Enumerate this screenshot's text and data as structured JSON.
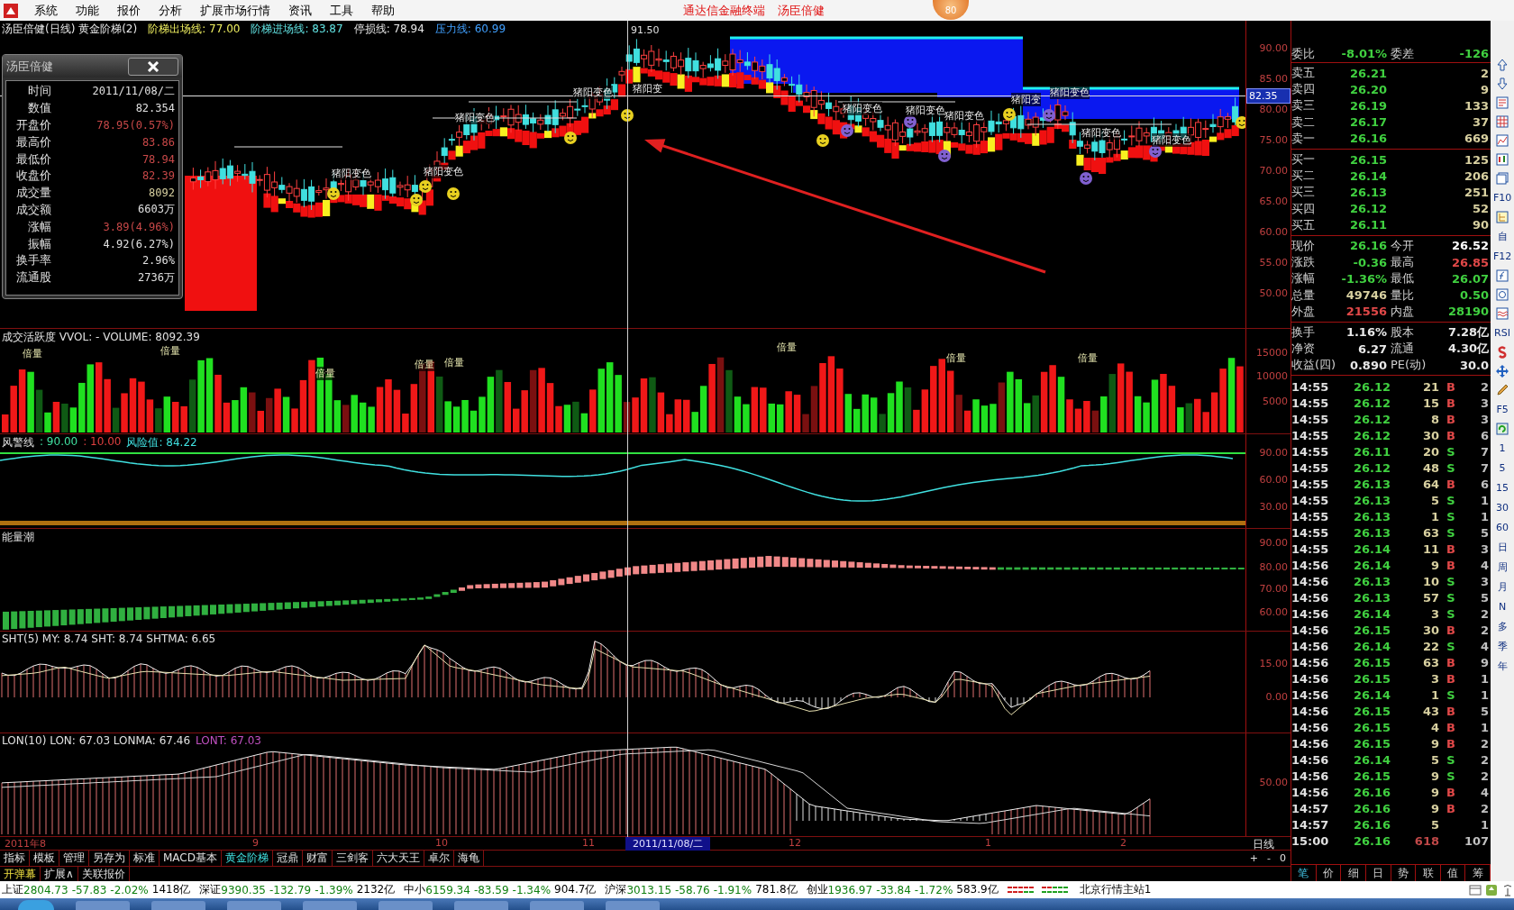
{
  "menu": [
    "系统",
    "功能",
    "报价",
    "分析",
    "扩展市场行情",
    "资讯",
    "工具",
    "帮助"
  ],
  "title": {
    "app": "通达信金融终端",
    "stock": "汤臣倍健",
    "badge": "80"
  },
  "main_chart": {
    "legend": [
      {
        "text": "汤臣倍健(日线) 黄金阶梯(2)",
        "color": "#e8e8e8"
      },
      {
        "text": "阶梯出场线: 77.00",
        "color": "#f0f060"
      },
      {
        "text": "阶梯进场线: 83.87",
        "color": "#60e0e0"
      },
      {
        "text": "停损线: 78.94",
        "color": "#e8e8e8"
      },
      {
        "text": "压力线: 60.99",
        "color": "#40a0ff"
      }
    ],
    "axis_labels": [
      "90.00",
      "85.00",
      "80.00",
      "75.00",
      "70.00",
      "65.00",
      "60.00",
      "55.00",
      "50.00"
    ],
    "cursor_price": "82.35",
    "peak_label": "91.50",
    "signals": [
      "猪阳变色",
      "猪阳变色",
      "猪阳变色",
      "猪阳变色",
      "猪阳变",
      "猪阳变色",
      "猪阳变色",
      "猪阳变色",
      "猪阳变",
      "猪阳变色",
      "猪阳变色",
      "猪阳变色"
    ]
  },
  "popup": {
    "title": "汤臣倍健",
    "rows": [
      {
        "label": "时间",
        "value": "2011/11/08/二",
        "color": "#e0e0e0"
      },
      {
        "label": "数值",
        "value": "82.354",
        "color": "#e0e0e0"
      },
      {
        "label": "开盘价",
        "value": "78.95(0.57%)",
        "color": "#c84848"
      },
      {
        "label": "最高价",
        "value": "83.86",
        "color": "#c84848"
      },
      {
        "label": "最低价",
        "value": "78.94",
        "color": "#c84848"
      },
      {
        "label": "收盘价",
        "value": "82.39",
        "color": "#c84848"
      },
      {
        "label": "成交量",
        "value": "8092",
        "color": "#d8d0a0"
      },
      {
        "label": "成交额",
        "value": "6603万",
        "color": "#e0e0e0"
      },
      {
        "label": "涨幅",
        "value": "3.89(4.96%)",
        "color": "#c84848"
      },
      {
        "label": "振幅",
        "value": "4.92(6.27%)",
        "color": "#e0e0e0"
      },
      {
        "label": "换手率",
        "value": "2.96%",
        "color": "#e0e0e0"
      },
      {
        "label": "流通股",
        "value": "2736万",
        "color": "#e0e0e0"
      }
    ]
  },
  "volume_panel": {
    "legend": "成交活跃度 VVOL: -   VOLUME: 8092.39",
    "axis_labels": [
      "15000",
      "10000",
      "5000"
    ],
    "markers": [
      "倍量",
      "倍量",
      "倍量",
      "倍量",
      "倍量",
      "倍量",
      "倍量",
      "倍量"
    ]
  },
  "warning_panel": {
    "name": "风警线",
    "upper": ": 90.00",
    "lower": ": 10.00",
    "risk": "风险值: 84.22",
    "axis_labels": [
      "90.00",
      "60.00",
      "30.00"
    ]
  },
  "energy_panel": {
    "legend": "能量潮",
    "axis_labels": [
      "90.00",
      "80.00",
      "70.00",
      "60.00"
    ]
  },
  "sht_panel": {
    "legend": "SHT(5)  MY: 8.74  SHT: 8.74  SHTMA: 6.65",
    "axis_labels": [
      "15.00",
      "0.00"
    ]
  },
  "lon_panel": {
    "legend": "LON(10)  LON: 67.03  LONMA: 67.46",
    "lont": "LONT: 67.03",
    "axis_labels": [
      "50.00"
    ]
  },
  "date_axis": {
    "labels": [
      "2011年8",
      "9",
      "10",
      "11",
      "12",
      "1",
      "2"
    ],
    "cursor_date": "2011/11/08/二",
    "period": "日线",
    "controls": [
      "+",
      "-",
      "0"
    ]
  },
  "tabs": [
    {
      "label": "指标",
      "selected": false
    },
    {
      "label": "模板",
      "selected": false
    },
    {
      "label": "管理",
      "selected": false
    },
    {
      "label": "另存为",
      "selected": false
    },
    {
      "label": "标准",
      "selected": false
    },
    {
      "label": "MACD基本",
      "selected": false
    },
    {
      "label": "黄金阶梯",
      "selected": true
    },
    {
      "label": "冠鼎",
      "selected": false
    },
    {
      "label": "财富",
      "selected": false
    },
    {
      "label": "三剑客",
      "selected": false
    },
    {
      "label": "六大天王",
      "selected": false
    },
    {
      "label": "卓尔",
      "selected": false
    },
    {
      "label": "海龟",
      "selected": false
    }
  ],
  "sub_tabs": [
    "开弹幕",
    "扩展∧",
    "关联报价"
  ],
  "quote": {
    "ratio": {
      "label": "委比",
      "value": "-8.01%",
      "label2": "委差",
      "value2": "-126"
    },
    "asks": [
      {
        "label": "卖五",
        "price": "26.21",
        "volume": "2"
      },
      {
        "label": "卖四",
        "price": "26.20",
        "volume": "9"
      },
      {
        "label": "卖三",
        "price": "26.19",
        "volume": "133"
      },
      {
        "label": "卖二",
        "price": "26.17",
        "volume": "37"
      },
      {
        "label": "卖一",
        "price": "26.16",
        "volume": "669"
      }
    ],
    "bids": [
      {
        "label": "买一",
        "price": "26.15",
        "volume": "125"
      },
      {
        "label": "买二",
        "price": "26.14",
        "volume": "206"
      },
      {
        "label": "买三",
        "price": "26.13",
        "volume": "251"
      },
      {
        "label": "买四",
        "price": "26.12",
        "volume": "52"
      },
      {
        "label": "买五",
        "price": "26.11",
        "volume": "90"
      }
    ],
    "stats": [
      {
        "left": {
          "label": "现价",
          "value": "26.16",
          "color": "#40d040"
        },
        "right": {
          "label": "今开",
          "value": "26.52",
          "color": "#ffffff"
        }
      },
      {
        "left": {
          "label": "涨跌",
          "value": "-0.36",
          "color": "#40d040"
        },
        "right": {
          "label": "最高",
          "value": "26.85",
          "color": "#e04848"
        }
      },
      {
        "left": {
          "label": "涨幅",
          "value": "-1.36%",
          "color": "#40d040"
        },
        "right": {
          "label": "最低",
          "value": "26.07",
          "color": "#40d040"
        }
      },
      {
        "left": {
          "label": "总量",
          "value": "49746",
          "color": "#d8d0a0"
        },
        "right": {
          "label": "量比",
          "value": "0.50",
          "color": "#40d040"
        }
      },
      {
        "left": {
          "label": "外盘",
          "value": "21556",
          "color": "#e04848"
        },
        "right": {
          "label": "内盘",
          "value": "28190",
          "color": "#40d040"
        }
      }
    ],
    "finance": [
      {
        "label": "换手",
        "value": "1.16%",
        "label2": "股本",
        "value2": "7.28亿"
      },
      {
        "label": "净资",
        "value": "6.27",
        "label2": "流通",
        "value2": "4.30亿"
      },
      {
        "label": "收益(四)",
        "value": "0.890",
        "label2": "PE(动)",
        "value2": "30.0"
      }
    ],
    "trades": [
      {
        "time": "14:55",
        "price": "26.12",
        "volume": "21",
        "kind": "buy",
        "side": "B",
        "count": "2"
      },
      {
        "time": "14:55",
        "price": "26.12",
        "volume": "15",
        "kind": "buy",
        "side": "B",
        "count": "3"
      },
      {
        "time": "14:55",
        "price": "26.12",
        "volume": "8",
        "kind": "buy",
        "side": "B",
        "count": "3"
      },
      {
        "time": "14:55",
        "price": "26.12",
        "volume": "30",
        "kind": "buy",
        "side": "B",
        "count": "6"
      },
      {
        "time": "14:55",
        "price": "26.11",
        "volume": "20",
        "kind": "sell",
        "side": "S",
        "count": "7"
      },
      {
        "time": "14:55",
        "price": "26.12",
        "volume": "48",
        "kind": "sell",
        "side": "S",
        "count": "7"
      },
      {
        "time": "14:55",
        "price": "26.13",
        "volume": "64",
        "kind": "buy",
        "side": "B",
        "count": "6"
      },
      {
        "time": "14:55",
        "price": "26.13",
        "volume": "5",
        "kind": "sell",
        "side": "S",
        "count": "1"
      },
      {
        "time": "14:55",
        "price": "26.13",
        "volume": "1",
        "kind": "sell",
        "side": "S",
        "count": "1"
      },
      {
        "time": "14:55",
        "price": "26.13",
        "volume": "63",
        "kind": "sell",
        "side": "S",
        "count": "5"
      },
      {
        "time": "14:55",
        "price": "26.14",
        "volume": "11",
        "kind": "buy",
        "side": "B",
        "count": "3"
      },
      {
        "time": "14:56",
        "price": "26.14",
        "volume": "9",
        "kind": "buy",
        "side": "B",
        "count": "4"
      },
      {
        "time": "14:56",
        "price": "26.13",
        "volume": "10",
        "kind": "sell",
        "side": "S",
        "count": "3"
      },
      {
        "time": "14:56",
        "price": "26.13",
        "volume": "57",
        "kind": "sell",
        "side": "S",
        "count": "5"
      },
      {
        "time": "14:56",
        "price": "26.14",
        "volume": "3",
        "kind": "sell",
        "side": "S",
        "count": "2"
      },
      {
        "time": "14:56",
        "price": "26.15",
        "volume": "30",
        "kind": "buy",
        "side": "B",
        "count": "2"
      },
      {
        "time": "14:56",
        "price": "26.14",
        "volume": "22",
        "kind": "sell",
        "side": "S",
        "count": "4"
      },
      {
        "time": "14:56",
        "price": "26.15",
        "volume": "63",
        "kind": "buy",
        "side": "B",
        "count": "9"
      },
      {
        "time": "14:56",
        "price": "26.15",
        "volume": "3",
        "kind": "buy",
        "side": "B",
        "count": "1"
      },
      {
        "time": "14:56",
        "price": "26.14",
        "volume": "1",
        "kind": "sell",
        "side": "S",
        "count": "1"
      },
      {
        "time": "14:56",
        "price": "26.15",
        "volume": "43",
        "kind": "buy",
        "side": "B",
        "count": "5"
      },
      {
        "time": "14:56",
        "price": "26.15",
        "volume": "4",
        "kind": "buy",
        "side": "B",
        "count": "1"
      },
      {
        "time": "14:56",
        "price": "26.15",
        "volume": "9",
        "kind": "buy",
        "side": "B",
        "count": "2"
      },
      {
        "time": "14:56",
        "price": "26.14",
        "volume": "5",
        "kind": "sell",
        "side": "S",
        "count": "2"
      },
      {
        "time": "14:56",
        "price": "26.15",
        "volume": "9",
        "kind": "sell",
        "side": "S",
        "count": "2"
      },
      {
        "time": "14:56",
        "price": "26.16",
        "volume": "9",
        "kind": "buy",
        "side": "B",
        "count": "4"
      },
      {
        "time": "14:57",
        "price": "26.16",
        "volume": "9",
        "kind": "buy",
        "side": "B",
        "count": "2"
      },
      {
        "time": "14:57",
        "price": "26.16",
        "volume": "5",
        "kind": "none",
        "count": "1"
      },
      {
        "time": "15:00",
        "price": "26.16",
        "volume": "618",
        "kind": "total",
        "count": "107"
      }
    ],
    "tabs": [
      {
        "label": "笔",
        "selected": true
      },
      {
        "label": "价",
        "selected": false
      },
      {
        "label": "细",
        "selected": false
      },
      {
        "label": "日",
        "selected": false
      },
      {
        "label": "势",
        "selected": false
      },
      {
        "label": "联",
        "selected": false
      },
      {
        "label": "值",
        "selected": false
      },
      {
        "label": "筹",
        "selected": false
      }
    ]
  },
  "toolbar": [
    {
      "kind": "up"
    },
    {
      "kind": "down"
    },
    {
      "kind": "report"
    },
    {
      "kind": "table"
    },
    {
      "kind": "line"
    },
    {
      "kind": "candles"
    },
    {
      "kind": "pages"
    },
    {
      "kind": "text",
      "label": "F10"
    },
    {
      "kind": "tree"
    },
    {
      "kind": "text",
      "label": "自"
    },
    {
      "kind": "text",
      "label": "F12"
    },
    {
      "kind": "formula"
    },
    {
      "kind": "ring"
    },
    {
      "kind": "wave"
    },
    {
      "kind": "text",
      "label": "RSI"
    },
    {
      "kind": "coin"
    },
    {
      "kind": "move"
    },
    {
      "kind": "pencil"
    },
    {
      "kind": "text",
      "label": "F5"
    },
    {
      "kind": "refresh"
    },
    {
      "kind": "text",
      "label": "1"
    },
    {
      "kind": "text",
      "label": "5"
    },
    {
      "kind": "text",
      "label": "15"
    },
    {
      "kind": "text",
      "label": "30"
    },
    {
      "kind": "text",
      "label": "60"
    },
    {
      "kind": "text",
      "label": "日"
    },
    {
      "kind": "text",
      "label": "周"
    },
    {
      "kind": "text",
      "label": "月"
    },
    {
      "kind": "text",
      "label": "N"
    },
    {
      "kind": "text",
      "label": "多"
    },
    {
      "kind": "text",
      "label": "季"
    },
    {
      "kind": "text",
      "label": "年"
    }
  ],
  "status_bar": {
    "indices": [
      {
        "name": "上证",
        "value": "2804.73",
        "change": "-57.83",
        "pct": "-2.02%",
        "amount": "1418亿"
      },
      {
        "name": "深证",
        "value": "9390.35",
        "change": "-132.79",
        "pct": "-1.39%",
        "amount": "2132亿"
      },
      {
        "name": "中小",
        "value": "6159.34",
        "change": "-83.59",
        "pct": "-1.34%",
        "amount": "904.7亿"
      },
      {
        "name": "沪深",
        "value": "3013.15",
        "change": "-58.76",
        "pct": "-1.91%",
        "amount": "781.8亿"
      },
      {
        "name": "创业",
        "value": "1936.97",
        "change": "-33.84",
        "pct": "-1.72%",
        "amount": "583.9亿"
      }
    ],
    "server": "北京行情主站1"
  }
}
